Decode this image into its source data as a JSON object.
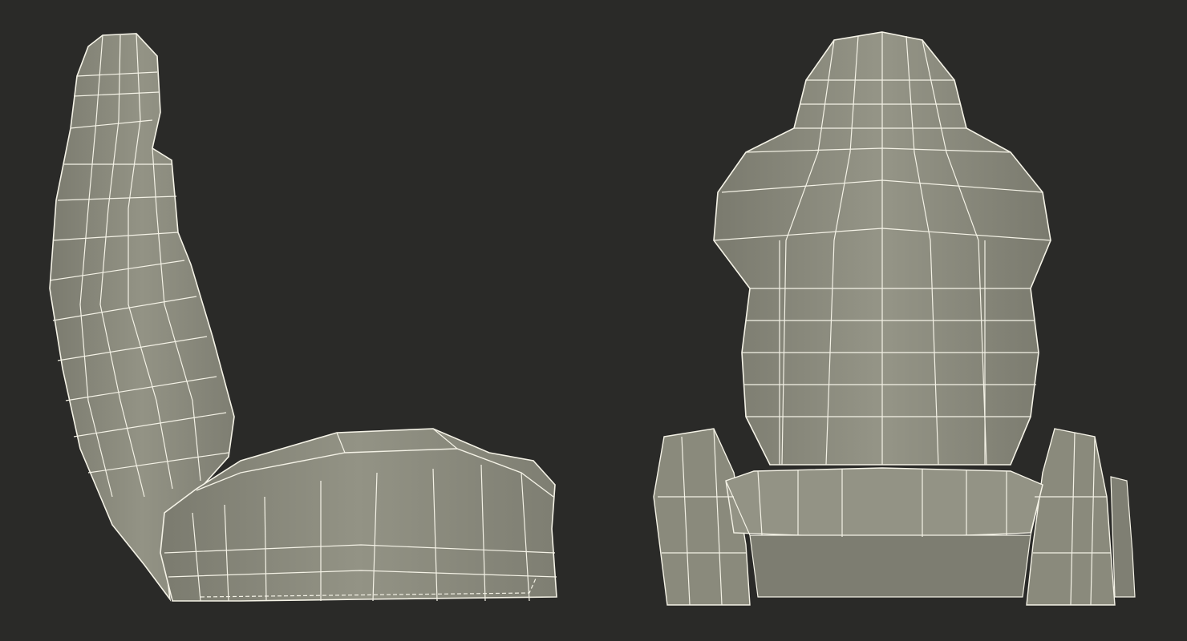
{
  "scene": {
    "background": "#2a2a28",
    "mesh_fill": "#8c8c7e",
    "mesh_shadow": "#6f6f63",
    "wire_color": "#f4f2e6",
    "views": [
      "side",
      "front"
    ]
  }
}
